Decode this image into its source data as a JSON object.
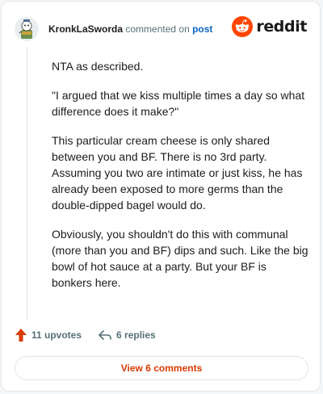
{
  "header": {
    "username": "KronkLaSworda",
    "commented_text": "commented on",
    "post_link": "post",
    "brand": "reddit"
  },
  "comment": {
    "paragraphs": [
      "NTA as described.",
      "\"I argued that we kiss multiple times a day so what difference does it make?\"",
      "This particular cream cheese is only shared between you and BF. There is no 3rd party. Assuming you two are intimate or just kiss, he has already been exposed to more germs than the double-dipped bagel would do.",
      "Obviously, you shouldn't do this with communal (more than you and BF) dips and such. Like the big bowl of hot sauce at a party. But your BF is bonkers here."
    ]
  },
  "actions": {
    "upvotes": "11 upvotes",
    "replies": "6 replies"
  },
  "footer": {
    "view_comments": "View 6 comments"
  },
  "colors": {
    "brand_orange": "#ff4500",
    "upvote": "#d93a00",
    "link": "#0a66c2",
    "muted": "#576f76"
  }
}
